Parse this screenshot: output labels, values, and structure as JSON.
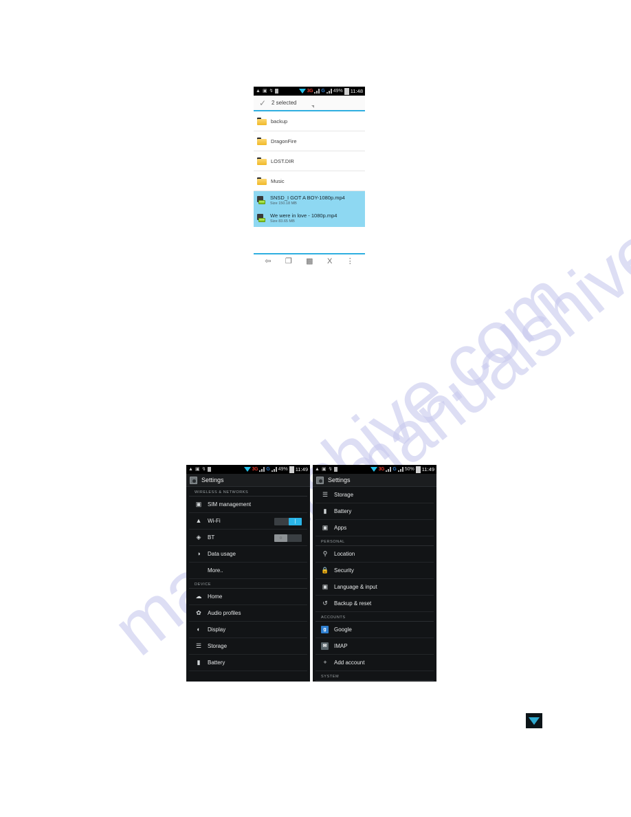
{
  "page": {
    "background": "#ffffff",
    "watermark_text": "manualshive.com",
    "watermark_color": "#c9caee"
  },
  "file_manager": {
    "statusbar": {
      "network_3g": "3G",
      "network_g": "G",
      "battery_percent": "49%",
      "time": "11:48"
    },
    "actionbar": {
      "check_icon": "check-icon",
      "selected_label": "2 selected",
      "dropdown_icon": "chevron-down-icon"
    },
    "items": [
      {
        "name": "backup",
        "type": "folder",
        "size": "",
        "selected": false
      },
      {
        "name": "DragonFire",
        "type": "folder",
        "size": "",
        "selected": false
      },
      {
        "name": "LOST.DIR",
        "type": "folder",
        "size": "",
        "selected": false
      },
      {
        "name": "Music",
        "type": "folder",
        "size": "",
        "selected": false
      },
      {
        "name": "SNSD_I GOT A BOY-1080p.mp4",
        "type": "video",
        "size": "Size 150.18 MB",
        "selected": true
      },
      {
        "name": "We were in love - 1080p.mp4",
        "type": "video",
        "size": "Size 83.65 MB",
        "selected": true
      }
    ],
    "toolbar": [
      {
        "icon": "share-icon",
        "glyph": "≪"
      },
      {
        "icon": "copy-icon",
        "glyph": "❐"
      },
      {
        "icon": "delete-icon",
        "glyph": "Ὕ1"
      },
      {
        "icon": "cut-icon",
        "glyph": "X"
      },
      {
        "icon": "overflow-menu-icon",
        "glyph": "⋮"
      }
    ],
    "selection_color": "#8ed8f2",
    "accent_color": "#2eaee0"
  },
  "settings_left": {
    "statusbar": {
      "network_3g": "3G",
      "network_g": "G",
      "battery_percent": "49%",
      "time": "11:49"
    },
    "title": "Settings",
    "sections": [
      {
        "header": "WIRELESS & NETWORKS",
        "rows": [
          {
            "label": "SIM management",
            "icon": "sim-card-icon",
            "glyph": "▣",
            "control": "none",
            "indent": false
          },
          {
            "label": "Wi-Fi",
            "icon": "wifi-icon",
            "glyph": "▲",
            "control": "toggle-on",
            "indent": false
          },
          {
            "label": "BT",
            "icon": "bluetooth-icon",
            "glyph": "ᛦ",
            "control": "toggle-off",
            "indent": false
          },
          {
            "label": "Data usage",
            "icon": "data-usage-icon",
            "glyph": "◑",
            "control": "none",
            "indent": false
          },
          {
            "label": "More..",
            "icon": "",
            "glyph": "",
            "control": "none",
            "indent": true
          }
        ]
      },
      {
        "header": "DEVICE",
        "rows": [
          {
            "label": "Home",
            "icon": "home-icon",
            "glyph": "☁",
            "control": "none",
            "indent": false
          },
          {
            "label": "Audio profiles",
            "icon": "audio-icon",
            "glyph": "✿",
            "control": "none",
            "indent": false
          },
          {
            "label": "Display",
            "icon": "display-icon",
            "glyph": "◐",
            "control": "none",
            "indent": false
          },
          {
            "label": "Storage",
            "icon": "storage-icon",
            "glyph": "☰",
            "control": "none",
            "indent": false
          },
          {
            "label": "Battery",
            "icon": "battery-icon",
            "glyph": "▮",
            "control": "none",
            "indent": false
          }
        ]
      }
    ],
    "toggle_on_color": "#2ab5e8",
    "toggle_off_color": "#8e9396"
  },
  "settings_right": {
    "statusbar": {
      "network_3g": "3G",
      "network_g": "G",
      "battery_percent": "50%",
      "time": "11:49"
    },
    "title": "Settings",
    "sections": [
      {
        "header": "",
        "rows": [
          {
            "label": "Storage",
            "icon": "storage-icon",
            "glyph": "☰",
            "control": "none",
            "indent": false
          },
          {
            "label": "Battery",
            "icon": "battery-icon",
            "glyph": "▮",
            "control": "none",
            "indent": false
          },
          {
            "label": "Apps",
            "icon": "apps-icon",
            "glyph": "▣",
            "control": "none",
            "indent": false
          }
        ]
      },
      {
        "header": "PERSONAL",
        "rows": [
          {
            "label": "Location",
            "icon": "location-pin-icon",
            "glyph": "▾",
            "control": "none",
            "indent": false
          },
          {
            "label": "Security",
            "icon": "lock-icon",
            "glyph": "■",
            "control": "none",
            "indent": false
          },
          {
            "label": "Language & input",
            "icon": "language-icon",
            "glyph": "A",
            "control": "none",
            "indent": false
          },
          {
            "label": "Backup & reset",
            "icon": "backup-reset-icon",
            "glyph": "↺",
            "control": "none",
            "indent": false
          }
        ]
      },
      {
        "header": "ACCOUNTS",
        "rows": [
          {
            "label": "Google",
            "icon": "google-account-icon",
            "glyph": "g",
            "control": "badge-blue",
            "indent": false
          },
          {
            "label": "IMAP",
            "icon": "imap-account-icon",
            "glyph": "✉",
            "control": "badge-grey",
            "indent": false
          },
          {
            "label": "Add account",
            "icon": "plus-icon",
            "glyph": "+",
            "control": "none",
            "indent": false
          }
        ]
      },
      {
        "header": "SYSTEM",
        "rows": []
      }
    ]
  },
  "wifi_chip": {
    "icon": "wifi-icon",
    "color": "#2fa9cf"
  }
}
